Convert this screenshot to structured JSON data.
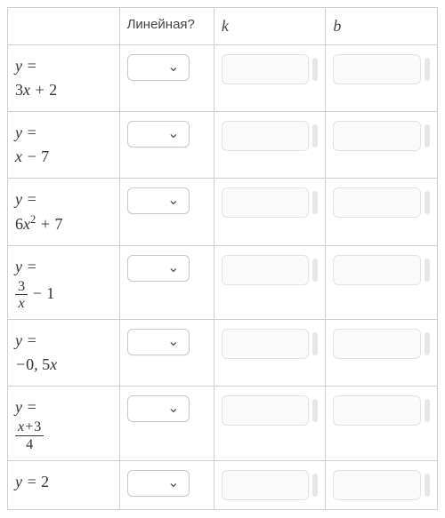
{
  "headers": {
    "equation": "",
    "linear": "Линейная?",
    "k": "k",
    "b": "b"
  },
  "chevron": "⌄",
  "rows": [
    {
      "eq_html": "<i>y</i> = <br><span class='num'>3</span><i>x</i> + <span class='num'>2</span>",
      "linear": "",
      "k": "",
      "b": ""
    },
    {
      "eq_html": "<i>y</i> = <br><i>x</i> − <span class='num'>7</span>",
      "linear": "",
      "k": "",
      "b": ""
    },
    {
      "eq_html": "<i>y</i> = <br><span class='num'>6</span><i>x</i><sup>2</sup> + <span class='num'>7</span>",
      "linear": "",
      "k": "",
      "b": ""
    },
    {
      "eq_html": "<i>y</i> = <br><span class='frac'><span class='top'><span class=\"num\">3</span></span><span class='bot'><i>x</i></span></span> − <span class='num'>1</span>",
      "linear": "",
      "k": "",
      "b": ""
    },
    {
      "eq_html": "<i>y</i> = <br>−<span class='num'>0</span>, <span class='num'>5</span><i>x</i>",
      "linear": "",
      "k": "",
      "b": ""
    },
    {
      "eq_html": "<i>y</i> = <br><span class='frac'><span class='top'><i>x</i>+<span class=\"num\">3</span></span><span class='bot'><span class=\"num\">4</span></span></span>",
      "linear": "",
      "k": "",
      "b": ""
    },
    {
      "eq_html": "<i>y</i> = <span class='num'>2</span>",
      "linear": "",
      "k": "",
      "b": ""
    }
  ]
}
